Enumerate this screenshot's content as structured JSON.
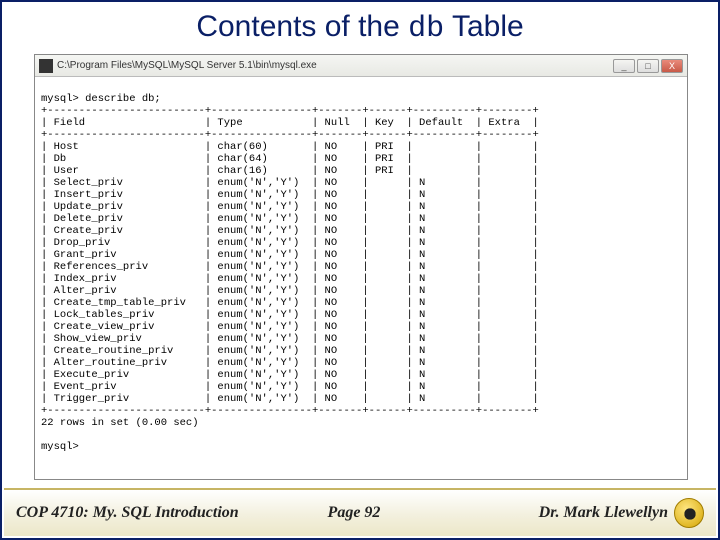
{
  "title_prefix": "Contents of the ",
  "title_code": "db",
  "title_suffix": " Table",
  "window_path": "C:\\Program Files\\MySQL\\MySQL Server 5.1\\bin\\mysql.exe",
  "win_controls": {
    "min": "_",
    "max": "□",
    "close": "X"
  },
  "prompt_cmd": "mysql> describe db;",
  "columns": [
    "Field",
    "Type",
    "Null",
    "Key",
    "Default",
    "Extra"
  ],
  "rows": [
    {
      "field": "Host",
      "type": "char(60)",
      "null": "NO",
      "key": "PRI",
      "default": "",
      "extra": ""
    },
    {
      "field": "Db",
      "type": "char(64)",
      "null": "NO",
      "key": "PRI",
      "default": "",
      "extra": ""
    },
    {
      "field": "User",
      "type": "char(16)",
      "null": "NO",
      "key": "PRI",
      "default": "",
      "extra": ""
    },
    {
      "field": "Select_priv",
      "type": "enum('N','Y')",
      "null": "NO",
      "key": "",
      "default": "N",
      "extra": ""
    },
    {
      "field": "Insert_priv",
      "type": "enum('N','Y')",
      "null": "NO",
      "key": "",
      "default": "N",
      "extra": ""
    },
    {
      "field": "Update_priv",
      "type": "enum('N','Y')",
      "null": "NO",
      "key": "",
      "default": "N",
      "extra": ""
    },
    {
      "field": "Delete_priv",
      "type": "enum('N','Y')",
      "null": "NO",
      "key": "",
      "default": "N",
      "extra": ""
    },
    {
      "field": "Create_priv",
      "type": "enum('N','Y')",
      "null": "NO",
      "key": "",
      "default": "N",
      "extra": ""
    },
    {
      "field": "Drop_priv",
      "type": "enum('N','Y')",
      "null": "NO",
      "key": "",
      "default": "N",
      "extra": ""
    },
    {
      "field": "Grant_priv",
      "type": "enum('N','Y')",
      "null": "NO",
      "key": "",
      "default": "N",
      "extra": ""
    },
    {
      "field": "References_priv",
      "type": "enum('N','Y')",
      "null": "NO",
      "key": "",
      "default": "N",
      "extra": ""
    },
    {
      "field": "Index_priv",
      "type": "enum('N','Y')",
      "null": "NO",
      "key": "",
      "default": "N",
      "extra": ""
    },
    {
      "field": "Alter_priv",
      "type": "enum('N','Y')",
      "null": "NO",
      "key": "",
      "default": "N",
      "extra": ""
    },
    {
      "field": "Create_tmp_table_priv",
      "type": "enum('N','Y')",
      "null": "NO",
      "key": "",
      "default": "N",
      "extra": ""
    },
    {
      "field": "Lock_tables_priv",
      "type": "enum('N','Y')",
      "null": "NO",
      "key": "",
      "default": "N",
      "extra": ""
    },
    {
      "field": "Create_view_priv",
      "type": "enum('N','Y')",
      "null": "NO",
      "key": "",
      "default": "N",
      "extra": ""
    },
    {
      "field": "Show_view_priv",
      "type": "enum('N','Y')",
      "null": "NO",
      "key": "",
      "default": "N",
      "extra": ""
    },
    {
      "field": "Create_routine_priv",
      "type": "enum('N','Y')",
      "null": "NO",
      "key": "",
      "default": "N",
      "extra": ""
    },
    {
      "field": "Alter_routine_priv",
      "type": "enum('N','Y')",
      "null": "NO",
      "key": "",
      "default": "N",
      "extra": ""
    },
    {
      "field": "Execute_priv",
      "type": "enum('N','Y')",
      "null": "NO",
      "key": "",
      "default": "N",
      "extra": ""
    },
    {
      "field": "Event_priv",
      "type": "enum('N','Y')",
      "null": "NO",
      "key": "",
      "default": "N",
      "extra": ""
    },
    {
      "field": "Trigger_priv",
      "type": "enum('N','Y')",
      "null": "NO",
      "key": "",
      "default": "N",
      "extra": ""
    }
  ],
  "result_msg": "22 rows in set (0.00 sec)",
  "prompt_idle": "mysql>",
  "footer": {
    "left": "COP 4710: My. SQL Introduction",
    "center": "Page 92",
    "right": "Dr. Mark Llewellyn"
  },
  "col_widths": {
    "field": 23,
    "type": 14,
    "null": 5,
    "key": 4,
    "default": 8,
    "extra": 6
  }
}
